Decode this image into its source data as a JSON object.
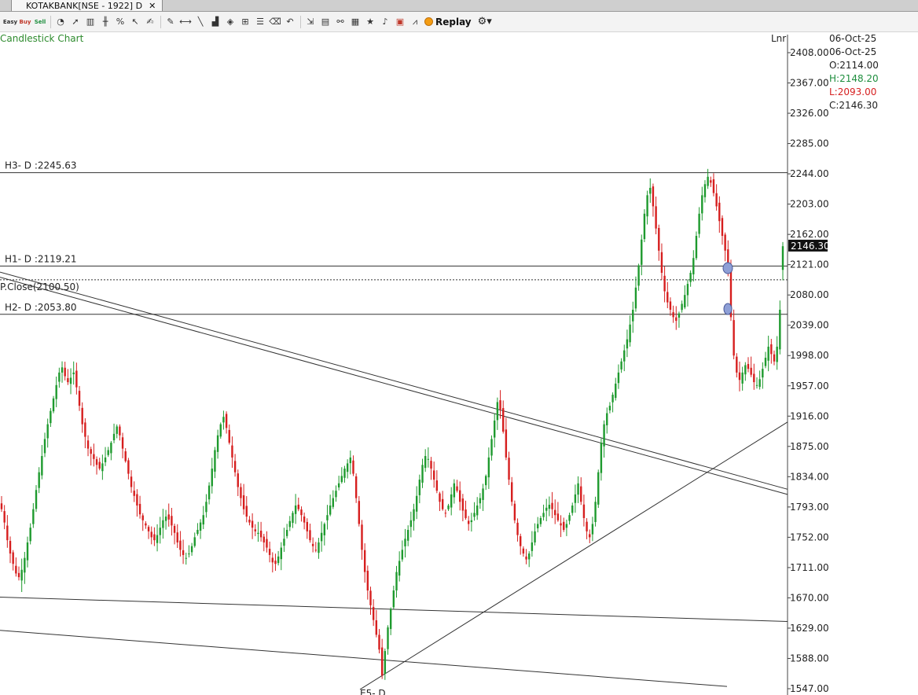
{
  "tab": {
    "title": "KOTAKBANK[NSE - 1922] D",
    "close": "✕"
  },
  "toolbar": {
    "icons": [
      "easy-icon",
      "buy-icon",
      "sell-icon",
      "clock-icon",
      "pointer-icon",
      "fibonacci-icon",
      "candle-icon",
      "percent-icon",
      "cursor-icon",
      "brush-icon",
      "pencil-icon",
      "hline-icon",
      "trendline-icon",
      "bar-chart-icon",
      "cube-icon",
      "grid-icon",
      "lines-icon",
      "eraser-icon",
      "undo-icon",
      "export-icon",
      "script-icon",
      "link-icon",
      "save-icon",
      "star-icon",
      "bell-icon",
      "delete-icon",
      "indicator-icon"
    ],
    "replay_label": "Replay"
  },
  "chart": {
    "title": "Candlestick Chart",
    "scale_label": "Lnr",
    "info": {
      "date1": "06-Oct-25",
      "date2": "06-Oct-25",
      "open": "O:2114.00",
      "high": "H:2148.20",
      "low": "L:2093.00",
      "close": "C:2146.30"
    },
    "last_price": "2146.30",
    "levels": {
      "h3": "H3- D :2245.63",
      "h1": "H1- D :2119.21",
      "pclose": "P.Close(2100.50)",
      "h2": "H2- D :2053.80",
      "e5": "E5- D"
    },
    "colors": {
      "up": "#1e9a2e",
      "down": "#d61e1e",
      "line": "#222222",
      "marker": "#8e9fd6"
    }
  },
  "chart_data": {
    "type": "candlestick",
    "y_ticks": [
      "2408.00",
      "2367.00",
      "2326.00",
      "2285.00",
      "2244.00",
      "2203.00",
      "2162.00",
      "2121.00",
      "2080.00",
      "2039.00",
      "1998.00",
      "1957.00",
      "1916.00",
      "1875.00",
      "1834.00",
      "1793.00",
      "1752.00",
      "1711.00",
      "1670.00",
      "1629.00",
      "1588.00",
      "1547.00"
    ],
    "ylim": [
      1547,
      2408
    ],
    "levels": {
      "H3": 2245.63,
      "H1": 2119.21,
      "P.Close": 2100.5,
      "H2": 2053.8
    },
    "last_close": 2146.3,
    "series_closes": [
      1790,
      1772,
      1748,
      1730,
      1716,
      1703,
      1698,
      1708,
      1724,
      1745,
      1765,
      1790,
      1816,
      1840,
      1862,
      1885,
      1905,
      1923,
      1940,
      1958,
      1975,
      1982,
      1970,
      1962,
      1968,
      1975,
      1955,
      1930,
      1905,
      1888,
      1872,
      1865,
      1858,
      1850,
      1845,
      1852,
      1860,
      1870,
      1880,
      1892,
      1902,
      1890,
      1872,
      1855,
      1838,
      1820,
      1808,
      1795,
      1783,
      1775,
      1768,
      1760,
      1752,
      1748,
      1755,
      1765,
      1775,
      1780,
      1776,
      1768,
      1758,
      1745,
      1735,
      1728,
      1724,
      1730,
      1740,
      1752,
      1762,
      1772,
      1782,
      1800,
      1822,
      1845,
      1870,
      1890,
      1905,
      1915,
      1900,
      1880,
      1860,
      1840,
      1820,
      1805,
      1790,
      1780,
      1772,
      1765,
      1760,
      1758,
      1752,
      1745,
      1738,
      1728,
      1718,
      1716,
      1726,
      1738,
      1750,
      1762,
      1774,
      1785,
      1795,
      1790,
      1782,
      1772,
      1760,
      1748,
      1740,
      1735,
      1745,
      1758,
      1770,
      1782,
      1795,
      1805,
      1815,
      1825,
      1835,
      1845,
      1852,
      1860,
      1838,
      1805,
      1770,
      1735,
      1705,
      1680,
      1660,
      1640,
      1620,
      1600,
      1565,
      1598,
      1630,
      1655,
      1680,
      1705,
      1720,
      1735,
      1750,
      1762,
      1775,
      1790,
      1808,
      1830,
      1850,
      1862,
      1858,
      1845,
      1830,
      1815,
      1800,
      1790,
      1785,
      1795,
      1810,
      1825,
      1815,
      1800,
      1788,
      1778,
      1770,
      1775,
      1785,
      1795,
      1805,
      1818,
      1835,
      1860,
      1885,
      1910,
      1935,
      1925,
      1895,
      1860,
      1830,
      1800,
      1775,
      1755,
      1740,
      1730,
      1722,
      1730,
      1745,
      1760,
      1770,
      1778,
      1785,
      1792,
      1796,
      1790,
      1782,
      1775,
      1768,
      1762,
      1770,
      1782,
      1795,
      1810,
      1825,
      1800,
      1778,
      1760,
      1752,
      1770,
      1800,
      1840,
      1880,
      1905,
      1920,
      1930,
      1945,
      1960,
      1975,
      1990,
      2005,
      2020,
      2040,
      2060,
      2090,
      2120,
      2155,
      2190,
      2215,
      2225,
      2200,
      2170,
      2140,
      2110,
      2085,
      2070,
      2060,
      2050,
      2045,
      2055,
      2068,
      2080,
      2095,
      2110,
      2130,
      2160,
      2190,
      2215,
      2230,
      2240,
      2232,
      2218,
      2200,
      2180,
      2160,
      2140,
      2120,
      2050,
      1998,
      1975,
      1965,
      1975,
      1985,
      1980,
      1972,
      1962,
      1958,
      1966,
      1980,
      1995,
      2010,
      2000,
      1990,
      2010,
      2060,
      2146
    ]
  }
}
